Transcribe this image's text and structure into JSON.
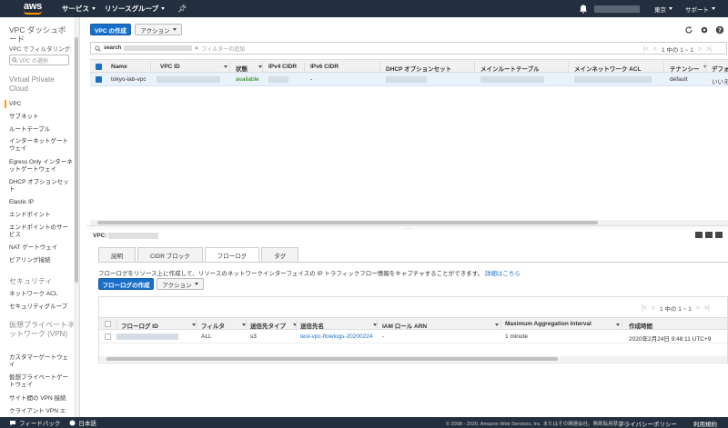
{
  "topbar": {
    "logo": "aws",
    "services": "サービス",
    "resource_groups": "リソースグループ",
    "region": "東京",
    "support": "サポート"
  },
  "sidebar": {
    "title": "VPC ダッシュボード",
    "filter_label": "VPC でフィルタリング:",
    "search_placeholder": "VPC の選択",
    "section_vpc": "Virtual Private Cloud",
    "items_vpc": [
      "VPC",
      "サブネット",
      "ルートテーブル",
      "インターネットゲートウェイ",
      "Egress Only インターネットゲートウェイ",
      "DHCP オプションセット",
      "Elastic IP",
      "エンドポイント",
      "エンドポイントのサービス",
      "NAT ゲートウェイ",
      "ピアリング接続"
    ],
    "section_security": "セキュリティ",
    "items_security": [
      "ネットワーク ACL",
      "セキュリティグループ"
    ],
    "section_vpn": "仮想プライベートネットワーク (VPN)",
    "items_vpn": [
      "カスタマーゲートウェイ",
      "仮想プライベートゲートウェイ",
      "サイト間の VPN 接続",
      "クライアント VPN エ"
    ]
  },
  "toolbar": {
    "create_vpc": "VPC の作成",
    "actions": "アクション"
  },
  "filter": {
    "search_tag": "search",
    "placeholder": "フィルターの追加"
  },
  "pager_top": {
    "text": "1 中の 1 ~ 1"
  },
  "vpc_table": {
    "headers": [
      "Name",
      "VPC ID",
      "状態",
      "IPv4 CIDR",
      "IPv6 CIDR",
      "DHCP オプションセット",
      "メインルートテーブル",
      "メインネットワーク ACL",
      "テナンシー",
      "デフォ"
    ],
    "row": {
      "name": "tokyo-lab-vpc",
      "state": "available",
      "ipv6": "-",
      "tenancy": "default",
      "default": "いいえ"
    }
  },
  "details": {
    "vpc_label": "VPC:",
    "tabs": [
      "説明",
      "CIDR ブロック",
      "フローログ",
      "タグ"
    ],
    "description": "フローログをリソース上に作成して、リソースのネットワークインターフェイスの IP トラフィックフロー情報をキャプチャすることができます。",
    "details_link": "詳細はこちら",
    "create_flowlog": "フローログの作成",
    "actions": "アクション",
    "pager": "1 中の 1 ~ 1"
  },
  "flowlog_table": {
    "headers": [
      "フローログ ID",
      "フィルタ",
      "送信先タイプ",
      "送信先名",
      "IAM ロール ARN",
      "Maximum Aggregation Interval",
      "作成時間"
    ],
    "row": {
      "filter": "ALL",
      "dest_type": "s3",
      "dest_name": "test-vpc-flowlogs-20200224",
      "iam_role": "-",
      "interval": "1 minute",
      "created": "2020年2月24日 9:48:11 UTC+9"
    }
  },
  "footer": {
    "feedback": "フィードバック",
    "language": "日本語",
    "copyright": "© 2008 - 2020, Amazon Web Services, Inc. またはその関連会社。無断転用禁止。",
    "privacy": "プライバシーポリシー",
    "terms": "利用規約"
  }
}
